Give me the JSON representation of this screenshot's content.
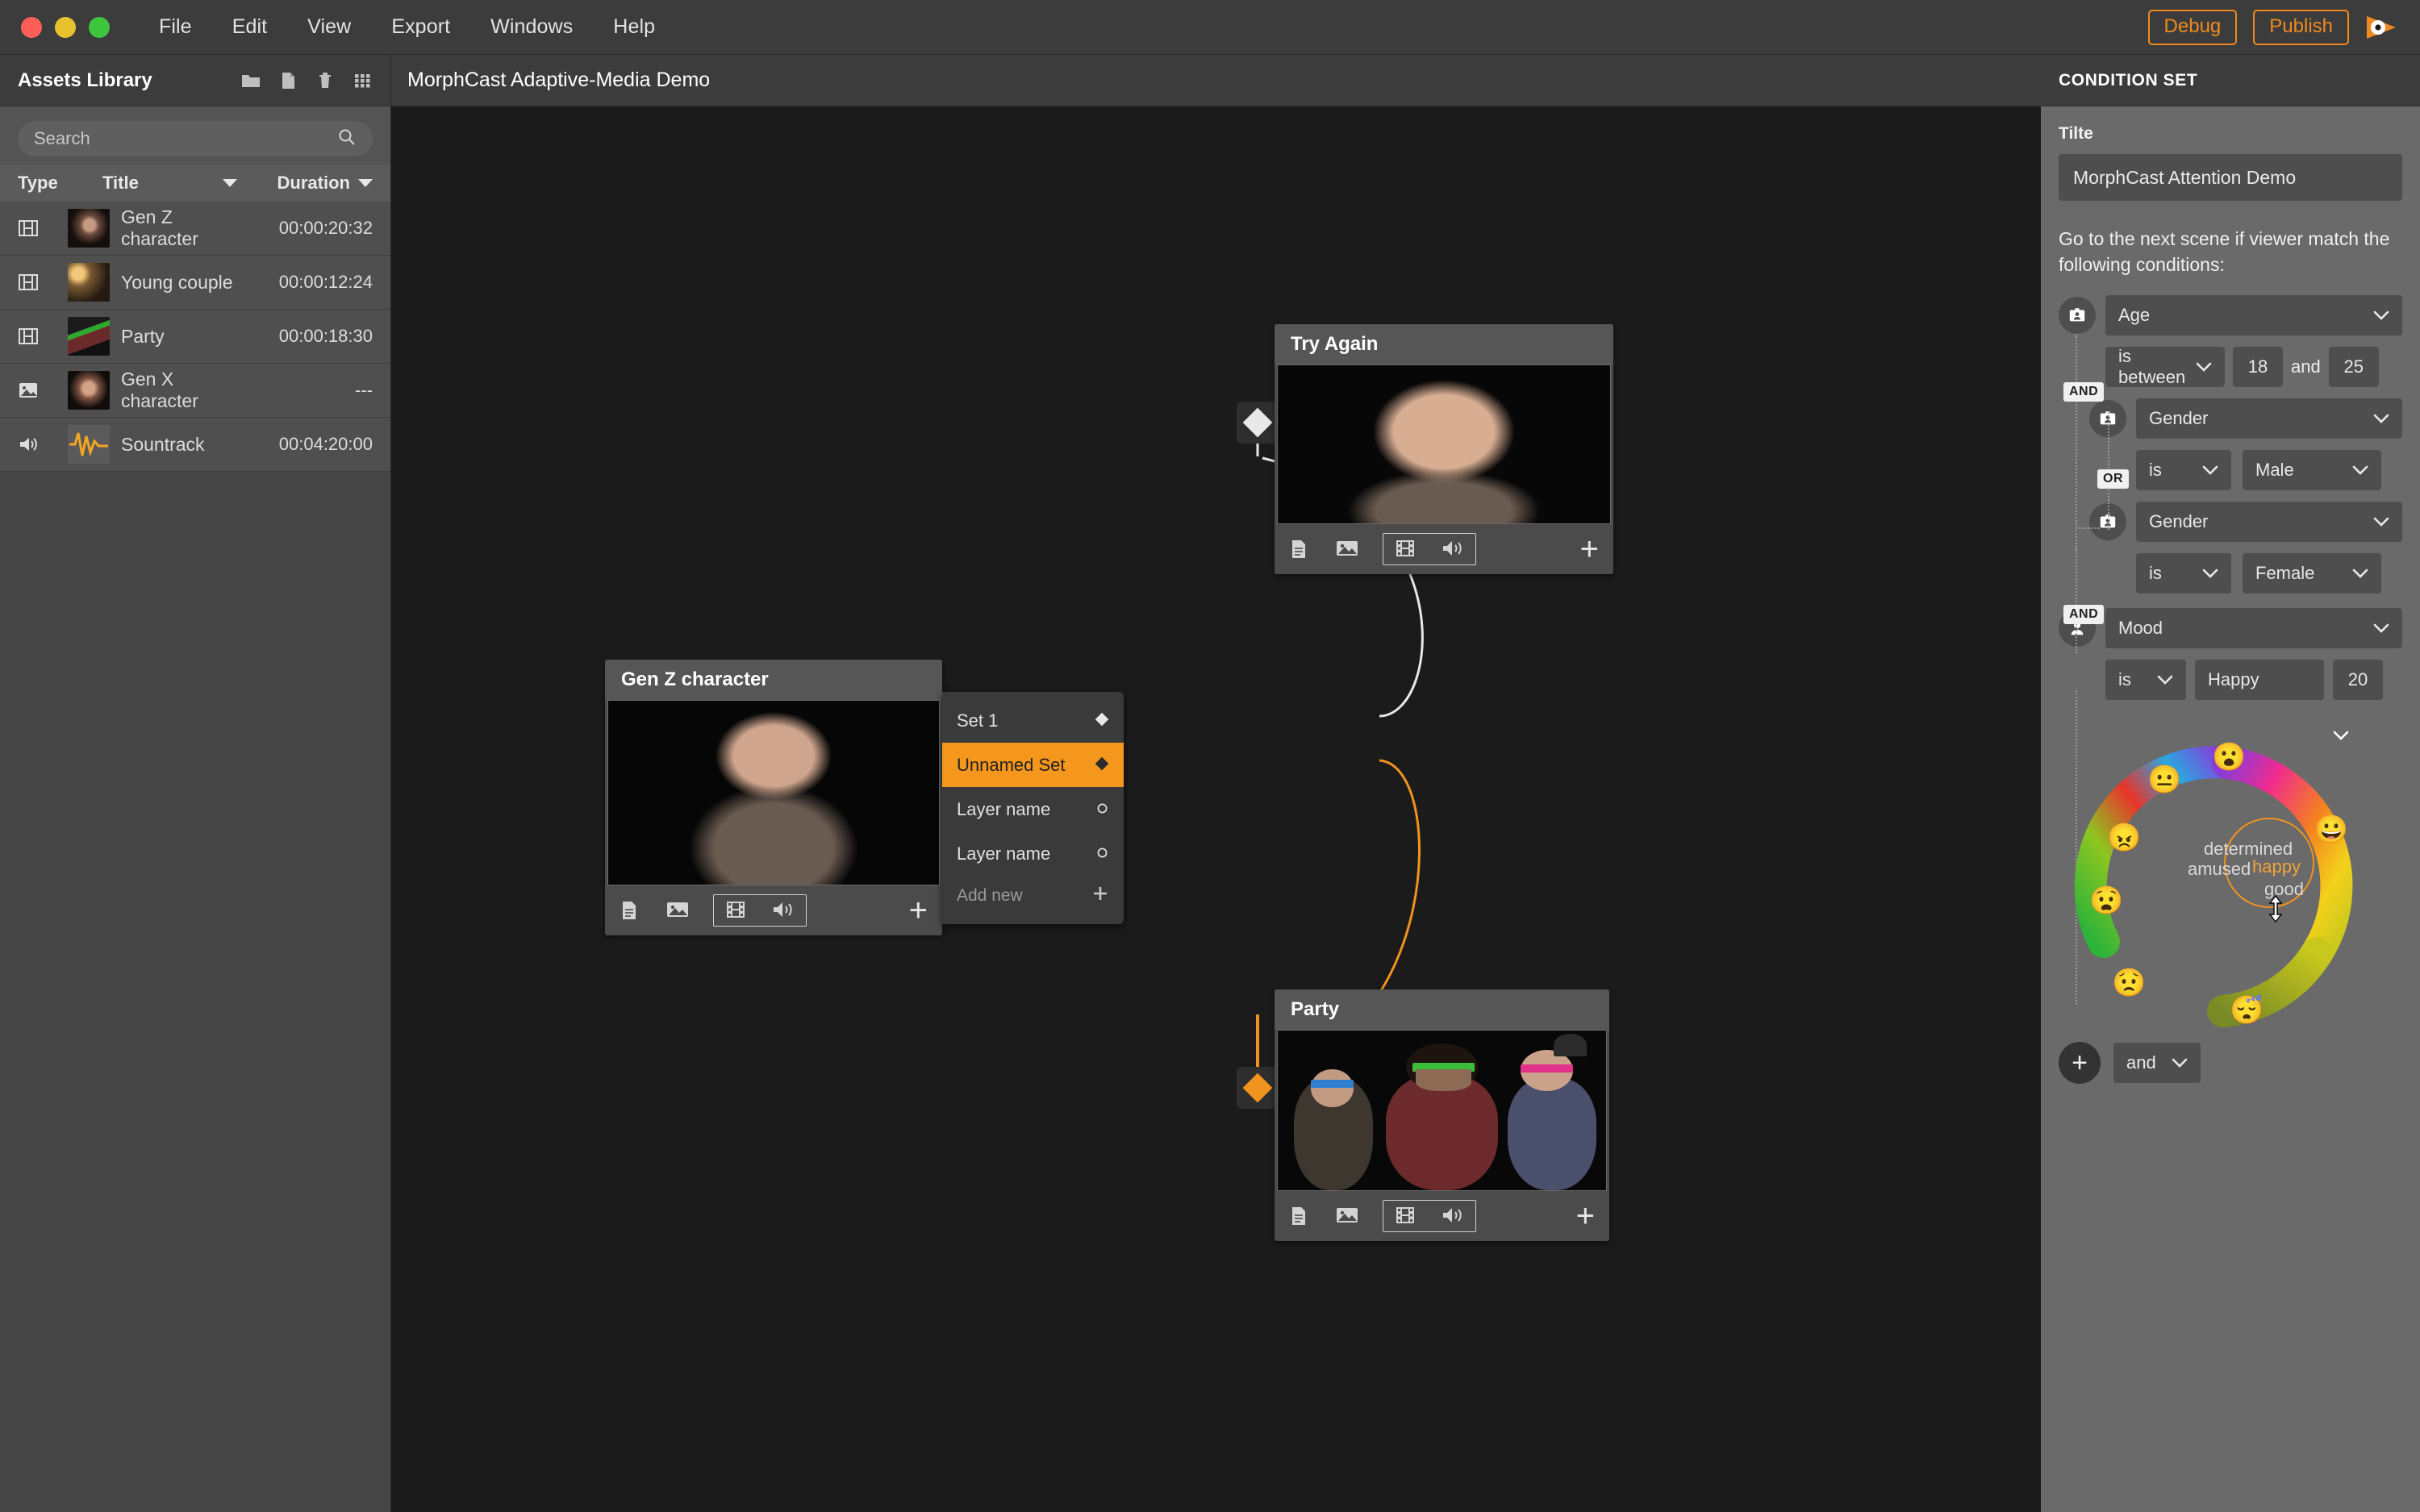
{
  "window": {
    "menu_items": [
      "File",
      "Edit",
      "View",
      "Export",
      "Windows",
      "Help"
    ],
    "debug_label": "Debug",
    "publish_label": "Publish",
    "accent_color": "#f08a1e"
  },
  "assets_library": {
    "title": "Assets Library",
    "toolbar_icons": [
      "folder-icon",
      "file-icon",
      "trash-icon",
      "grid-icon"
    ],
    "search": {
      "placeholder": "Search",
      "value": ""
    },
    "columns": [
      "Type",
      "Title",
      "Duration"
    ],
    "rows": [
      {
        "type": "video",
        "title": "Gen Z character",
        "duration": "00:00:20:32",
        "thumb": "th-genz"
      },
      {
        "type": "video",
        "title": "Young couple",
        "duration": "00:00:12:24",
        "thumb": "th-couple"
      },
      {
        "type": "video",
        "title": "Party",
        "duration": "00:00:18:30",
        "thumb": "th-party"
      },
      {
        "type": "image",
        "title": "Gen X character",
        "duration": "---",
        "thumb": "th-genx"
      },
      {
        "type": "audio",
        "title": "Sountrack",
        "duration": "00:04:20:00",
        "thumb": "th-audio"
      }
    ]
  },
  "canvas": {
    "project_title": "MorphCast Adaptive-Media Demo",
    "nodes": {
      "genz": {
        "title": "Gen Z character"
      },
      "tryagain": {
        "title": "Try Again"
      },
      "party": {
        "title": "Party"
      }
    },
    "node_footer_icons": [
      "text-icon",
      "image-icon",
      "film-icon",
      "audio-icon",
      "add-icon"
    ],
    "set_menu": {
      "items": [
        {
          "label": "Set 1",
          "marker": "diamond",
          "active": false
        },
        {
          "label": "Unnamed Set",
          "marker": "diamond",
          "active": true
        },
        {
          "label": "Layer name",
          "marker": "circle",
          "active": false
        },
        {
          "label": "Layer name",
          "marker": "circle",
          "active": false
        }
      ],
      "add_new_label": "Add new"
    }
  },
  "condition_set": {
    "header": "CONDITION SET",
    "title_label": "Tilte",
    "title_value": "MorphCast Attention Demo",
    "description": "Go to the next scene if viewer match the following conditions:",
    "conditions": [
      {
        "icon": "badge-icon",
        "attribute": "Age",
        "operator": "is between",
        "value_a": "18",
        "joiner": "and",
        "value_b": "25",
        "logic_after": "AND"
      },
      {
        "icon": "badge-icon",
        "attribute": "Gender",
        "operator": "is",
        "value_a": "Male",
        "logic_after": "OR"
      },
      {
        "icon": "badge-icon",
        "attribute": "Gender",
        "operator": "is",
        "value_a": "Female",
        "logic_after": "AND"
      },
      {
        "icon": "person-icon",
        "attribute": "Mood",
        "operator": "is",
        "value_a": "Happy",
        "value_b": "20"
      }
    ],
    "emotion_wheel": {
      "labels": [
        "determined",
        "amused",
        "happy",
        "good"
      ],
      "highlighted_label": "happy",
      "emojis": [
        "😮",
        "😐",
        "😠",
        "😧",
        "😟",
        "😴",
        "😀"
      ]
    },
    "footer_joiner": "and",
    "add_label": "+"
  }
}
